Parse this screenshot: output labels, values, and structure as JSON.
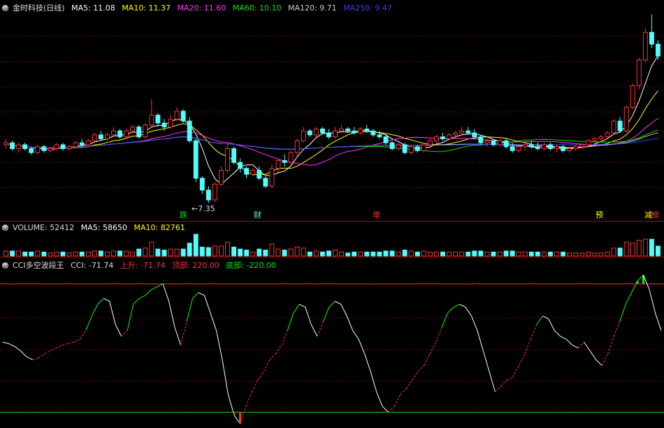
{
  "colors": {
    "up": "#ff3232",
    "down": "#54fcfc",
    "ma5": "#ffffff",
    "ma10": "#ffff00",
    "ma20": "#ff33ff",
    "ma60": "#00e600",
    "ma120": "#cccccc",
    "ma250": "#3c3cff",
    "grid": "#7a0000",
    "cci_up": "#ff3232",
    "cci_flat": "#ffffff",
    "cci_green": "#00ff00"
  },
  "header": {
    "title": "金时科技(日线)",
    "ma5": "MA5: 11.08",
    "ma10": "MA10: 11.37",
    "ma20": "MA20: 11.60",
    "ma60": "MA60: 10.10",
    "ma120": "MA120: 9.71",
    "ma250": "MA250: 9.47"
  },
  "volume_header": {
    "title": "VOLUME: 52412",
    "ma5": "MA5: 58650",
    "ma10": "MA10: 82761"
  },
  "cci_header": {
    "title": "CCI多空波段王",
    "cci": "CCI: -71.74",
    "rise": "上升: -71.74",
    "top": "顶部: 220.00",
    "bottom": "底部: -220.00"
  },
  "annotations": {
    "low_price": "7.35",
    "tags": [
      {
        "text": "跌",
        "color": "#00e600"
      },
      {
        "text": "财",
        "color": "#54fcfc"
      },
      {
        "text": "增",
        "color": "#ff3232"
      },
      {
        "text": "预",
        "color": "#ffff00"
      },
      {
        "text": "减",
        "color": "#ffff00"
      },
      {
        "text": "榜",
        "color": "#ff3232"
      }
    ]
  },
  "chart_data": [
    {
      "type": "candlestick",
      "title": "金时科技(日线)",
      "x_unit": "trading day index",
      "y_range": [
        7.0,
        17.0
      ],
      "candles_ohlc": [
        [
          10.3,
          10.6,
          10.1,
          10.4
        ],
        [
          10.4,
          10.5,
          10.0,
          10.1
        ],
        [
          10.1,
          10.4,
          9.9,
          10.3
        ],
        [
          10.3,
          10.4,
          10.0,
          10.1
        ],
        [
          10.1,
          10.2,
          9.8,
          9.9
        ],
        [
          9.9,
          10.3,
          9.8,
          10.2
        ],
        [
          10.2,
          10.3,
          9.9,
          10.0
        ],
        [
          10.0,
          10.2,
          9.9,
          10.1
        ],
        [
          10.1,
          10.4,
          10.0,
          10.3
        ],
        [
          10.3,
          10.4,
          10.0,
          10.1
        ],
        [
          10.1,
          10.3,
          10.0,
          10.2
        ],
        [
          10.2,
          10.5,
          10.1,
          10.4
        ],
        [
          10.4,
          10.6,
          10.2,
          10.3
        ],
        [
          10.3,
          10.6,
          10.2,
          10.5
        ],
        [
          10.5,
          10.9,
          10.4,
          10.8
        ],
        [
          10.8,
          11.0,
          10.5,
          10.6
        ],
        [
          10.6,
          10.9,
          10.5,
          10.8
        ],
        [
          10.8,
          11.2,
          10.7,
          11.0
        ],
        [
          11.0,
          11.1,
          10.6,
          10.7
        ],
        [
          10.7,
          11.1,
          10.6,
          11.0
        ],
        [
          11.0,
          11.3,
          10.9,
          11.2
        ],
        [
          11.2,
          11.3,
          10.6,
          10.7
        ],
        [
          10.7,
          11.4,
          10.6,
          11.3
        ],
        [
          11.3,
          12.6,
          11.2,
          11.8
        ],
        [
          11.8,
          11.9,
          11.2,
          11.4
        ],
        [
          11.4,
          11.6,
          11.0,
          11.2
        ],
        [
          11.2,
          11.8,
          11.1,
          11.6
        ],
        [
          11.6,
          12.2,
          11.5,
          12.0
        ],
        [
          12.0,
          12.1,
          11.4,
          11.5
        ],
        [
          11.5,
          11.7,
          10.4,
          10.5
        ],
        [
          10.5,
          10.6,
          8.4,
          8.6
        ],
        [
          8.6,
          8.7,
          7.8,
          8.0
        ],
        [
          8.0,
          8.2,
          7.35,
          7.5
        ],
        [
          7.5,
          8.4,
          7.4,
          8.3
        ],
        [
          8.3,
          9.2,
          8.2,
          9.0
        ],
        [
          9.0,
          10.3,
          8.9,
          10.1
        ],
        [
          10.1,
          10.2,
          9.3,
          9.4
        ],
        [
          9.4,
          9.6,
          8.9,
          9.1
        ],
        [
          9.1,
          9.2,
          8.6,
          8.8
        ],
        [
          8.8,
          9.1,
          8.7,
          9.0
        ],
        [
          9.0,
          9.2,
          8.5,
          8.6
        ],
        [
          8.6,
          8.7,
          8.1,
          8.2
        ],
        [
          8.2,
          9.3,
          8.1,
          9.1
        ],
        [
          9.1,
          9.6,
          8.9,
          9.5
        ],
        [
          9.5,
          9.8,
          9.2,
          9.4
        ],
        [
          9.4,
          10.0,
          9.3,
          9.9
        ],
        [
          9.9,
          10.6,
          9.7,
          10.5
        ],
        [
          10.5,
          11.2,
          10.4,
          11.0
        ],
        [
          11.0,
          11.1,
          10.7,
          10.8
        ],
        [
          10.8,
          11.2,
          10.7,
          11.1
        ],
        [
          11.1,
          11.2,
          10.8,
          10.9
        ],
        [
          10.9,
          11.1,
          10.6,
          10.7
        ],
        [
          10.7,
          11.2,
          10.6,
          11.0
        ],
        [
          11.0,
          11.3,
          10.9,
          11.1
        ],
        [
          11.1,
          11.2,
          10.9,
          11.0
        ],
        [
          11.0,
          11.2,
          10.8,
          10.9
        ],
        [
          10.9,
          11.2,
          10.8,
          11.1
        ],
        [
          11.1,
          11.3,
          10.9,
          11.0
        ],
        [
          11.0,
          11.1,
          10.7,
          10.8
        ],
        [
          10.8,
          11.0,
          10.6,
          10.7
        ],
        [
          10.7,
          10.8,
          10.3,
          10.4
        ],
        [
          10.4,
          10.5,
          10.0,
          10.1
        ],
        [
          10.1,
          10.4,
          10.0,
          10.3
        ],
        [
          10.3,
          10.4,
          9.8,
          9.9
        ],
        [
          9.9,
          10.3,
          9.8,
          10.2
        ],
        [
          10.2,
          10.3,
          9.9,
          10.0
        ],
        [
          10.0,
          10.4,
          9.9,
          10.3
        ],
        [
          10.3,
          10.6,
          10.2,
          10.5
        ],
        [
          10.5,
          10.8,
          10.4,
          10.7
        ],
        [
          10.7,
          10.9,
          10.5,
          10.6
        ],
        [
          10.6,
          10.9,
          10.5,
          10.8
        ],
        [
          10.8,
          11.0,
          10.6,
          10.9
        ],
        [
          10.9,
          11.2,
          10.8,
          11.0
        ],
        [
          11.0,
          11.2,
          10.8,
          10.9
        ],
        [
          10.9,
          11.1,
          10.6,
          10.7
        ],
        [
          10.7,
          10.8,
          10.3,
          10.4
        ],
        [
          10.4,
          10.6,
          10.2,
          10.5
        ],
        [
          10.5,
          10.6,
          10.2,
          10.3
        ],
        [
          10.3,
          10.6,
          10.2,
          10.5
        ],
        [
          10.5,
          10.6,
          10.1,
          10.2
        ],
        [
          10.2,
          10.4,
          9.9,
          10.0
        ],
        [
          10.0,
          10.3,
          9.9,
          10.2
        ],
        [
          10.2,
          10.4,
          10.0,
          10.3
        ],
        [
          10.3,
          10.5,
          10.1,
          10.2
        ],
        [
          10.2,
          10.4,
          10.0,
          10.1
        ],
        [
          10.1,
          10.4,
          10.0,
          10.3
        ],
        [
          10.3,
          10.4,
          10.0,
          10.1
        ],
        [
          10.1,
          10.3,
          9.9,
          10.2
        ],
        [
          10.2,
          10.3,
          9.9,
          10.0
        ],
        [
          10.0,
          10.2,
          9.9,
          10.1
        ],
        [
          10.1,
          10.3,
          10.0,
          10.2
        ],
        [
          10.2,
          10.4,
          10.1,
          10.3
        ],
        [
          10.3,
          10.6,
          10.2,
          10.5
        ],
        [
          10.5,
          10.7,
          10.4,
          10.6
        ],
        [
          10.6,
          10.8,
          10.5,
          10.7
        ],
        [
          10.7,
          11.0,
          10.6,
          10.9
        ],
        [
          10.9,
          11.6,
          10.8,
          11.5
        ],
        [
          11.5,
          11.7,
          10.9,
          11.0
        ],
        [
          11.0,
          12.3,
          10.9,
          12.2
        ],
        [
          12.2,
          13.4,
          12.1,
          13.3
        ],
        [
          13.3,
          14.7,
          13.1,
          14.6
        ],
        [
          14.6,
          16.2,
          14.5,
          16.0
        ],
        [
          16.0,
          16.9,
          15.2,
          15.4
        ],
        [
          15.4,
          15.6,
          14.6,
          14.8
        ]
      ],
      "ma_values_latest": {
        "MA5": 11.08,
        "MA10": 11.37,
        "MA20": 11.6,
        "MA60": 10.1,
        "MA120": 9.71,
        "MA250": 9.47
      },
      "annotation": {
        "low": 7.35
      }
    },
    {
      "type": "bar",
      "title": "VOLUME",
      "values_latest": {
        "VOLUME": 52412,
        "MA5": 58650,
        "MA10": 82761
      }
    },
    {
      "type": "line",
      "title": "CCI多空波段王",
      "y_range": [
        -260,
        270
      ],
      "reference_lines": {
        "top": 220.0,
        "bottom": -220.0
      },
      "values": [
        20,
        15,
        5,
        -10,
        -30,
        -40,
        -35,
        -20,
        -10,
        0,
        10,
        15,
        20,
        30,
        60,
        110,
        150,
        170,
        160,
        80,
        40,
        60,
        150,
        170,
        180,
        200,
        210,
        220,
        160,
        70,
        10,
        90,
        170,
        190,
        180,
        120,
        60,
        -40,
        -160,
        -230,
        -260,
        -200,
        -150,
        -110,
        -80,
        -40,
        -20,
        10,
        60,
        120,
        150,
        140,
        80,
        40,
        90,
        140,
        160,
        150,
        110,
        60,
        30,
        -20,
        -80,
        -150,
        -200,
        -220,
        -200,
        -160,
        -140,
        -110,
        -80,
        -60,
        -20,
        20,
        70,
        120,
        140,
        150,
        140,
        110,
        60,
        -10,
        -80,
        -150,
        -130,
        -110,
        -100,
        -60,
        -20,
        30,
        80,
        110,
        100,
        60,
        40,
        30,
        10,
        0,
        20,
        -10,
        -40,
        -60,
        -20,
        40,
        90,
        150,
        190,
        230,
        250,
        200,
        120,
        60
      ]
    }
  ]
}
